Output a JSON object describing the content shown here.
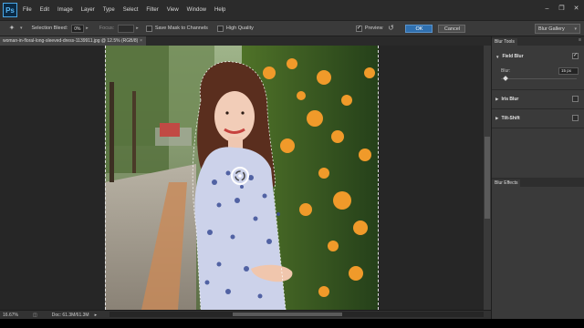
{
  "app": {
    "logo": "Ps"
  },
  "menu": [
    "File",
    "Edit",
    "Image",
    "Layer",
    "Type",
    "Select",
    "Filter",
    "View",
    "Window",
    "Help"
  ],
  "options_bar": {
    "selection_bleed_label": "Selection Bleed:",
    "selection_bleed_value": "0%",
    "focus_label": "Focus:",
    "save_mask_label": "Save Mask to Channels",
    "high_quality_label": "High Quality",
    "preview_label": "Preview",
    "ok_label": "OK",
    "cancel_label": "Cancel",
    "gallery_label": "Blur Gallery"
  },
  "document": {
    "tab_title": "woman-in-floral-long-sleeved-dress-1139911.jpg @ 12.5% (RGB/8)",
    "zoom": "16.67%",
    "doc_size": "Doc: 61.3M/61.3M"
  },
  "blur_tools": {
    "panel_title": "Blur Tools",
    "items": [
      {
        "name": "Field Blur",
        "expanded": true,
        "checked": true
      },
      {
        "name": "Iris Blur",
        "expanded": false,
        "checked": false
      },
      {
        "name": "Tilt-Shift",
        "expanded": false,
        "checked": false
      }
    ],
    "blur_label": "Blur:",
    "blur_value": "15 px",
    "blur_level": 0.06
  },
  "blur_effects": {
    "panel_title": "Blur Effects"
  },
  "colors": {
    "accent": "#2f6fae",
    "ps_blue": "#5ab6f2"
  }
}
